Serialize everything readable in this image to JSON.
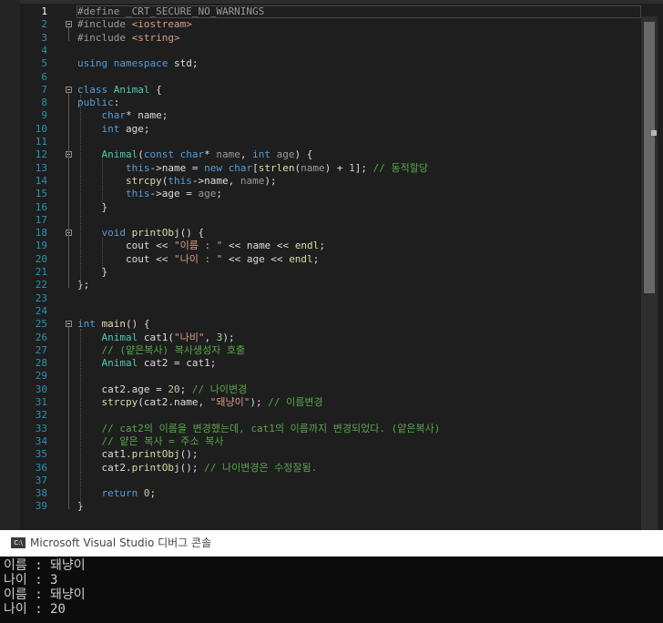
{
  "editor": {
    "current_line": 1,
    "lines": [
      {
        "n": "1",
        "tokens": [
          {
            "c": "pp",
            "t": "#define _CRT_SECURE_NO_WARNINGS"
          }
        ]
      },
      {
        "n": "2",
        "tokens": [
          {
            "c": "pp",
            "t": "#include "
          },
          {
            "c": "str",
            "t": "<iostream>"
          }
        ]
      },
      {
        "n": "3",
        "tokens": [
          {
            "c": "pp",
            "t": "#include "
          },
          {
            "c": "str",
            "t": "<string>"
          }
        ]
      },
      {
        "n": "4",
        "tokens": []
      },
      {
        "n": "5",
        "tokens": [
          {
            "c": "kw",
            "t": "using"
          },
          {
            "c": "plain",
            "t": " "
          },
          {
            "c": "kw",
            "t": "namespace"
          },
          {
            "c": "plain",
            "t": " std;"
          }
        ]
      },
      {
        "n": "6",
        "tokens": []
      },
      {
        "n": "7",
        "tokens": [
          {
            "c": "kw",
            "t": "class"
          },
          {
            "c": "plain",
            "t": " "
          },
          {
            "c": "type",
            "t": "Animal"
          },
          {
            "c": "plain",
            "t": " {"
          }
        ]
      },
      {
        "n": "8",
        "tokens": [
          {
            "c": "kw",
            "t": "public"
          },
          {
            "c": "plain",
            "t": ":"
          }
        ]
      },
      {
        "n": "9",
        "tokens": [
          {
            "c": "plain",
            "t": "    "
          },
          {
            "c": "kw",
            "t": "char"
          },
          {
            "c": "plain",
            "t": "* name;"
          }
        ]
      },
      {
        "n": "10",
        "tokens": [
          {
            "c": "plain",
            "t": "    "
          },
          {
            "c": "kw",
            "t": "int"
          },
          {
            "c": "plain",
            "t": " age;"
          }
        ]
      },
      {
        "n": "11",
        "tokens": []
      },
      {
        "n": "12",
        "tokens": [
          {
            "c": "plain",
            "t": "    "
          },
          {
            "c": "type",
            "t": "Animal"
          },
          {
            "c": "plain",
            "t": "("
          },
          {
            "c": "kw",
            "t": "const"
          },
          {
            "c": "plain",
            "t": " "
          },
          {
            "c": "kw",
            "t": "char"
          },
          {
            "c": "plain",
            "t": "* "
          },
          {
            "c": "param",
            "t": "name"
          },
          {
            "c": "plain",
            "t": ", "
          },
          {
            "c": "kw",
            "t": "int"
          },
          {
            "c": "plain",
            "t": " "
          },
          {
            "c": "param",
            "t": "age"
          },
          {
            "c": "plain",
            "t": ") {"
          }
        ]
      },
      {
        "n": "13",
        "tokens": [
          {
            "c": "plain",
            "t": "        "
          },
          {
            "c": "kw",
            "t": "this"
          },
          {
            "c": "plain",
            "t": "->name = "
          },
          {
            "c": "kw",
            "t": "new"
          },
          {
            "c": "plain",
            "t": " "
          },
          {
            "c": "kw",
            "t": "char"
          },
          {
            "c": "plain",
            "t": "["
          },
          {
            "c": "fn",
            "t": "strlen"
          },
          {
            "c": "plain",
            "t": "("
          },
          {
            "c": "param",
            "t": "name"
          },
          {
            "c": "plain",
            "t": ") + "
          },
          {
            "c": "num",
            "t": "1"
          },
          {
            "c": "plain",
            "t": "]; "
          },
          {
            "c": "com",
            "t": "// 동적할당"
          }
        ]
      },
      {
        "n": "14",
        "tokens": [
          {
            "c": "plain",
            "t": "        "
          },
          {
            "c": "fn",
            "t": "strcpy"
          },
          {
            "c": "plain",
            "t": "("
          },
          {
            "c": "kw",
            "t": "this"
          },
          {
            "c": "plain",
            "t": "->name, "
          },
          {
            "c": "param",
            "t": "name"
          },
          {
            "c": "plain",
            "t": ");"
          }
        ]
      },
      {
        "n": "15",
        "tokens": [
          {
            "c": "plain",
            "t": "        "
          },
          {
            "c": "kw",
            "t": "this"
          },
          {
            "c": "plain",
            "t": "->age = "
          },
          {
            "c": "param",
            "t": "age"
          },
          {
            "c": "plain",
            "t": ";"
          }
        ]
      },
      {
        "n": "16",
        "tokens": [
          {
            "c": "plain",
            "t": "    }"
          }
        ]
      },
      {
        "n": "17",
        "tokens": []
      },
      {
        "n": "18",
        "tokens": [
          {
            "c": "plain",
            "t": "    "
          },
          {
            "c": "kw",
            "t": "void"
          },
          {
            "c": "plain",
            "t": " "
          },
          {
            "c": "fn",
            "t": "printObj"
          },
          {
            "c": "plain",
            "t": "() {"
          }
        ]
      },
      {
        "n": "19",
        "tokens": [
          {
            "c": "plain",
            "t": "        cout << "
          },
          {
            "c": "str",
            "t": "\"이름 : \""
          },
          {
            "c": "plain",
            "t": " << name << "
          },
          {
            "c": "fn",
            "t": "endl"
          },
          {
            "c": "plain",
            "t": ";"
          }
        ]
      },
      {
        "n": "20",
        "tokens": [
          {
            "c": "plain",
            "t": "        cout << "
          },
          {
            "c": "str",
            "t": "\"나이 : \""
          },
          {
            "c": "plain",
            "t": " << age << "
          },
          {
            "c": "fn",
            "t": "endl"
          },
          {
            "c": "plain",
            "t": ";"
          }
        ]
      },
      {
        "n": "21",
        "tokens": [
          {
            "c": "plain",
            "t": "    }"
          }
        ]
      },
      {
        "n": "22",
        "tokens": [
          {
            "c": "plain",
            "t": "};"
          }
        ]
      },
      {
        "n": "23",
        "tokens": []
      },
      {
        "n": "24",
        "tokens": []
      },
      {
        "n": "25",
        "tokens": [
          {
            "c": "kw",
            "t": "int"
          },
          {
            "c": "plain",
            "t": " "
          },
          {
            "c": "fn",
            "t": "main"
          },
          {
            "c": "plain",
            "t": "() {"
          }
        ]
      },
      {
        "n": "26",
        "tokens": [
          {
            "c": "plain",
            "t": "    "
          },
          {
            "c": "type",
            "t": "Animal"
          },
          {
            "c": "plain",
            "t": " cat1("
          },
          {
            "c": "str",
            "t": "\"나비\""
          },
          {
            "c": "plain",
            "t": ", "
          },
          {
            "c": "num",
            "t": "3"
          },
          {
            "c": "plain",
            "t": ");"
          }
        ]
      },
      {
        "n": "27",
        "tokens": [
          {
            "c": "plain",
            "t": "    "
          },
          {
            "c": "com",
            "t": "// (얕은복사) 복사생성자 호출"
          }
        ]
      },
      {
        "n": "28",
        "tokens": [
          {
            "c": "plain",
            "t": "    "
          },
          {
            "c": "type",
            "t": "Animal"
          },
          {
            "c": "plain",
            "t": " cat2 = cat1;"
          }
        ]
      },
      {
        "n": "29",
        "tokens": []
      },
      {
        "n": "30",
        "tokens": [
          {
            "c": "plain",
            "t": "    cat2.age = "
          },
          {
            "c": "num",
            "t": "20"
          },
          {
            "c": "plain",
            "t": "; "
          },
          {
            "c": "com",
            "t": "// 나이변경"
          }
        ]
      },
      {
        "n": "31",
        "tokens": [
          {
            "c": "plain",
            "t": "    "
          },
          {
            "c": "fn",
            "t": "strcpy"
          },
          {
            "c": "plain",
            "t": "(cat2.name, "
          },
          {
            "c": "str",
            "t": "\"돼냥이\""
          },
          {
            "c": "plain",
            "t": "); "
          },
          {
            "c": "com",
            "t": "// 이름변경"
          }
        ]
      },
      {
        "n": "32",
        "tokens": []
      },
      {
        "n": "33",
        "tokens": [
          {
            "c": "plain",
            "t": "    "
          },
          {
            "c": "com",
            "t": "// cat2의 이름을 변경했는데, cat1의 이름까지 변경되었다. (얕은복사)"
          }
        ]
      },
      {
        "n": "34",
        "tokens": [
          {
            "c": "plain",
            "t": "    "
          },
          {
            "c": "com",
            "t": "// 얕은 복사 = 주소 복사"
          }
        ]
      },
      {
        "n": "35",
        "tokens": [
          {
            "c": "plain",
            "t": "    cat1."
          },
          {
            "c": "fn",
            "t": "printObj"
          },
          {
            "c": "plain",
            "t": "();"
          }
        ]
      },
      {
        "n": "36",
        "tokens": [
          {
            "c": "plain",
            "t": "    cat2."
          },
          {
            "c": "fn",
            "t": "printObj"
          },
          {
            "c": "plain",
            "t": "(); "
          },
          {
            "c": "com",
            "t": "// 나이변경은 수정잘됨."
          }
        ]
      },
      {
        "n": "37",
        "tokens": []
      },
      {
        "n": "38",
        "tokens": [
          {
            "c": "plain",
            "t": "    "
          },
          {
            "c": "kw",
            "t": "return"
          },
          {
            "c": "plain",
            "t": " "
          },
          {
            "c": "num",
            "t": "0"
          },
          {
            "c": "plain",
            "t": ";"
          }
        ]
      },
      {
        "n": "39",
        "tokens": [
          {
            "c": "plain",
            "t": "}"
          }
        ]
      }
    ]
  },
  "console": {
    "icon_label": "C:\\",
    "title": "Microsoft Visual Studio 디버그 콘솔",
    "output": [
      "이름 : 돼냥이",
      "나이 : 3",
      "이름 : 돼냥이",
      "나이 : 20"
    ]
  },
  "colors": {
    "editor_bg": "#1e1e1e",
    "line_number": "#2b91af",
    "keyword": "#569cd6",
    "type": "#4ec9b0",
    "string": "#d69d85",
    "comment": "#57a64a",
    "console_bg": "#0c0c0c"
  }
}
